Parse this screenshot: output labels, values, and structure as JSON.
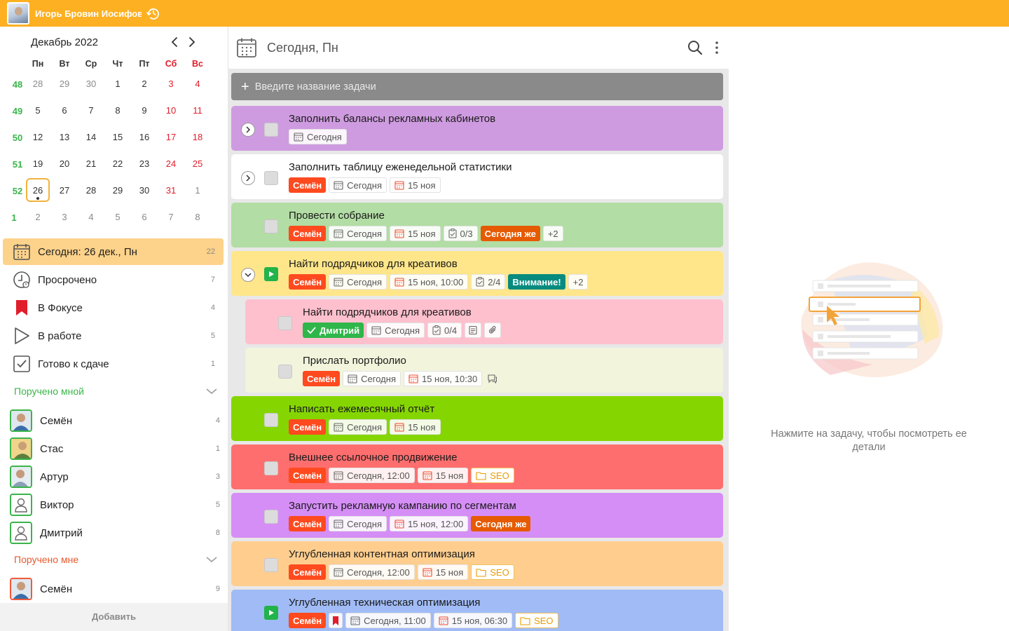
{
  "topbar": {
    "user_name": "Игорь Бровин Иосифович"
  },
  "calendar": {
    "month_title": "Декабрь 2022",
    "weekdays": [
      "Пн",
      "Вт",
      "Ср",
      "Чт",
      "Пт",
      "Сб",
      "Вс"
    ],
    "weeks": [
      {
        "num": "48",
        "days": [
          "28",
          "29",
          "30",
          "1",
          "2",
          "3",
          "4"
        ]
      },
      {
        "num": "49",
        "days": [
          "5",
          "6",
          "7",
          "8",
          "9",
          "10",
          "11"
        ]
      },
      {
        "num": "50",
        "days": [
          "12",
          "13",
          "14",
          "15",
          "16",
          "17",
          "18"
        ]
      },
      {
        "num": "51",
        "days": [
          "19",
          "20",
          "21",
          "22",
          "23",
          "24",
          "25"
        ]
      },
      {
        "num": "52",
        "days": [
          "26",
          "27",
          "28",
          "29",
          "30",
          "31",
          "1"
        ]
      },
      {
        "num": "1",
        "days": [
          "2",
          "3",
          "4",
          "5",
          "6",
          "7",
          "8"
        ]
      }
    ]
  },
  "nav": {
    "today": {
      "label": "Сегодня: 26 дек., Пн",
      "count": "22"
    },
    "overdue": {
      "label": "Просрочено",
      "count": "7"
    },
    "focus": {
      "label": "В Фокусе",
      "count": "4"
    },
    "inwork": {
      "label": "В работе",
      "count": "5"
    },
    "ready": {
      "label": "Готово к сдаче",
      "count": "1"
    }
  },
  "assigned_by_me": {
    "title": "Поручено мной",
    "people": [
      {
        "name": "Семён",
        "count": "4"
      },
      {
        "name": "Стас",
        "count": "1"
      },
      {
        "name": "Артур",
        "count": "3"
      },
      {
        "name": "Виктор",
        "count": "5"
      },
      {
        "name": "Дмитрий",
        "count": "8"
      }
    ]
  },
  "assigned_to_me": {
    "title": "Поручено мне",
    "people": [
      {
        "name": "Семён",
        "count": "9"
      }
    ]
  },
  "sidebar_add": "Добавить",
  "center": {
    "title": "Сегодня, Пн",
    "add_placeholder": "Введите название задачи"
  },
  "tasks": [
    {
      "title": "Заполнить балансы рекламных кабинетов",
      "tags": {
        "today": "Сегодня"
      }
    },
    {
      "title": "Заполнить таблицу еженедельной статистики",
      "tags": {
        "who": "Семён",
        "today": "Сегодня",
        "due": "15 ноя"
      }
    },
    {
      "title": "Провести собрание",
      "tags": {
        "who": "Семён",
        "today": "Сегодня",
        "due": "15 ноя",
        "check": "0/3",
        "label": "Сегодня же",
        "more": "+2"
      }
    },
    {
      "title": "Найти подрядчиков для креативов",
      "tags": {
        "who": "Семён",
        "today": "Сегодня",
        "due": "15 ноя, 10:00",
        "check": "2/4",
        "label": "Внимание!",
        "more": "+2"
      }
    },
    {
      "title": "Найти подрядчиков для креативов",
      "tags": {
        "who": "Дмитрий",
        "today": "Сегодня",
        "check": "0/4"
      }
    },
    {
      "title": "Прислать портфолио",
      "tags": {
        "who": "Семён",
        "today": "Сегодня",
        "due": "15 ноя, 10:30"
      }
    },
    {
      "title": "Написать ежемесячный отчёт",
      "tags": {
        "who": "Семён",
        "today": "Сегодня",
        "due": "15 ноя"
      }
    },
    {
      "title": "Внешнее ссылочное продвижение",
      "tags": {
        "who": "Семён",
        "today": "Сегодня, 12:00",
        "due": "15 ноя",
        "project": "SEO"
      }
    },
    {
      "title": "Запустить рекламную кампанию по сегментам",
      "tags": {
        "who": "Семён",
        "today": "Сегодня",
        "due": "15 ноя, 12:00",
        "label": "Сегодня же"
      }
    },
    {
      "title": "Углубленная контентная оптимизация",
      "tags": {
        "who": "Семён",
        "today": "Сегодня, 12:00",
        "due": "15 ноя",
        "project": "SEO"
      }
    },
    {
      "title": "Углубленная техническая оптимизация",
      "tags": {
        "who": "Семён",
        "today": "Сегодня, 11:00",
        "due": "15 ноя, 06:30",
        "project": "SEO"
      }
    }
  ],
  "details": {
    "hint": "Нажмите на задачу, чтобы посмотреть ее детали"
  },
  "colors": {
    "topbar": "#fdb022",
    "task_purple": "#cf9be0",
    "task_green": "#b2dda4",
    "task_yellow": "#ffe68a",
    "task_pink": "#ffc0ce",
    "task_cream": "#f2f5dc",
    "task_lime": "#85d600",
    "task_red": "#ff6e6e",
    "task_violet": "#d58ef6",
    "task_peach": "#ffce8f",
    "task_blue": "#a0bbf6"
  }
}
